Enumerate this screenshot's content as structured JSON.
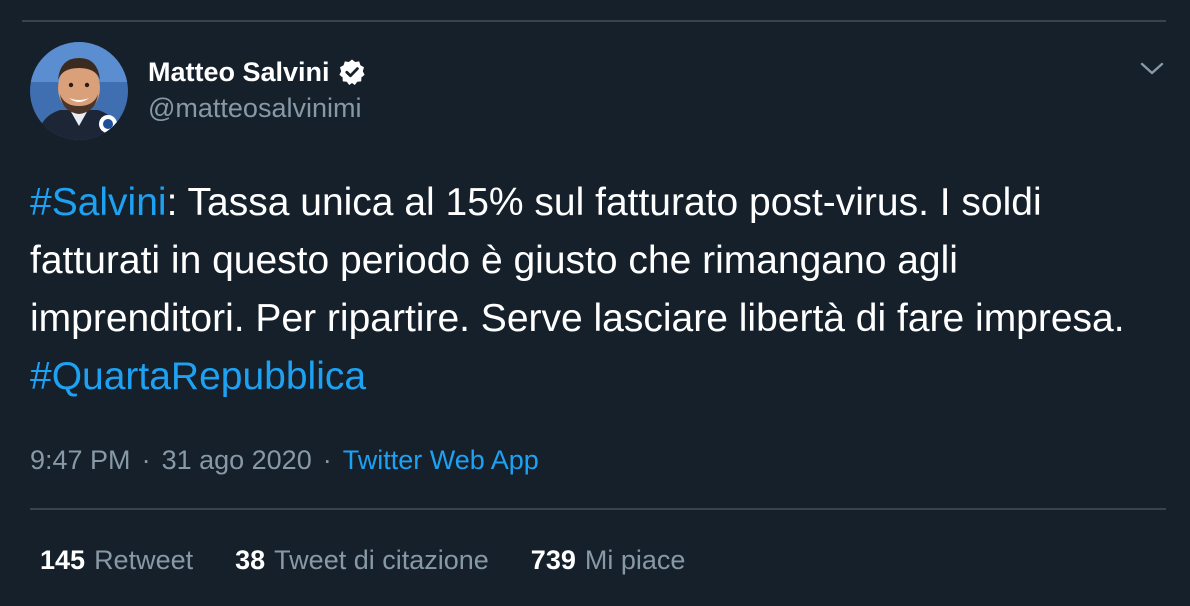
{
  "tweet": {
    "author": {
      "display_name": "Matteo Salvini",
      "handle": "@matteosalvinimi",
      "verified": true,
      "avatar_icon": "profile-photo"
    },
    "text": {
      "segments": [
        {
          "type": "hashtag",
          "text": "#Salvini"
        },
        {
          "type": "text",
          "text": ": Tassa unica al 15% sul fatturato post-virus. I soldi fatturati in questo periodo è giusto che rimangano agli imprenditori. Per ripartire. Serve lasciare libertà di fare impresa. "
        },
        {
          "type": "hashtag",
          "text": "#QuartaRepubblica"
        }
      ]
    },
    "meta": {
      "time": "9:47 PM",
      "separator": "·",
      "date": "31 ago 2020",
      "source": "Twitter Web App"
    },
    "stats": [
      {
        "value": "145",
        "label": "Retweet"
      },
      {
        "value": "38",
        "label": "Tweet di citazione"
      },
      {
        "value": "739",
        "label": "Mi piace"
      }
    ],
    "menu_icon": "chevron-down-icon"
  },
  "colors": {
    "background": "#15202b",
    "divider": "#38444d",
    "accent": "#1da1f2",
    "secondary_text": "#8899a6",
    "primary_text": "#ffffff"
  }
}
